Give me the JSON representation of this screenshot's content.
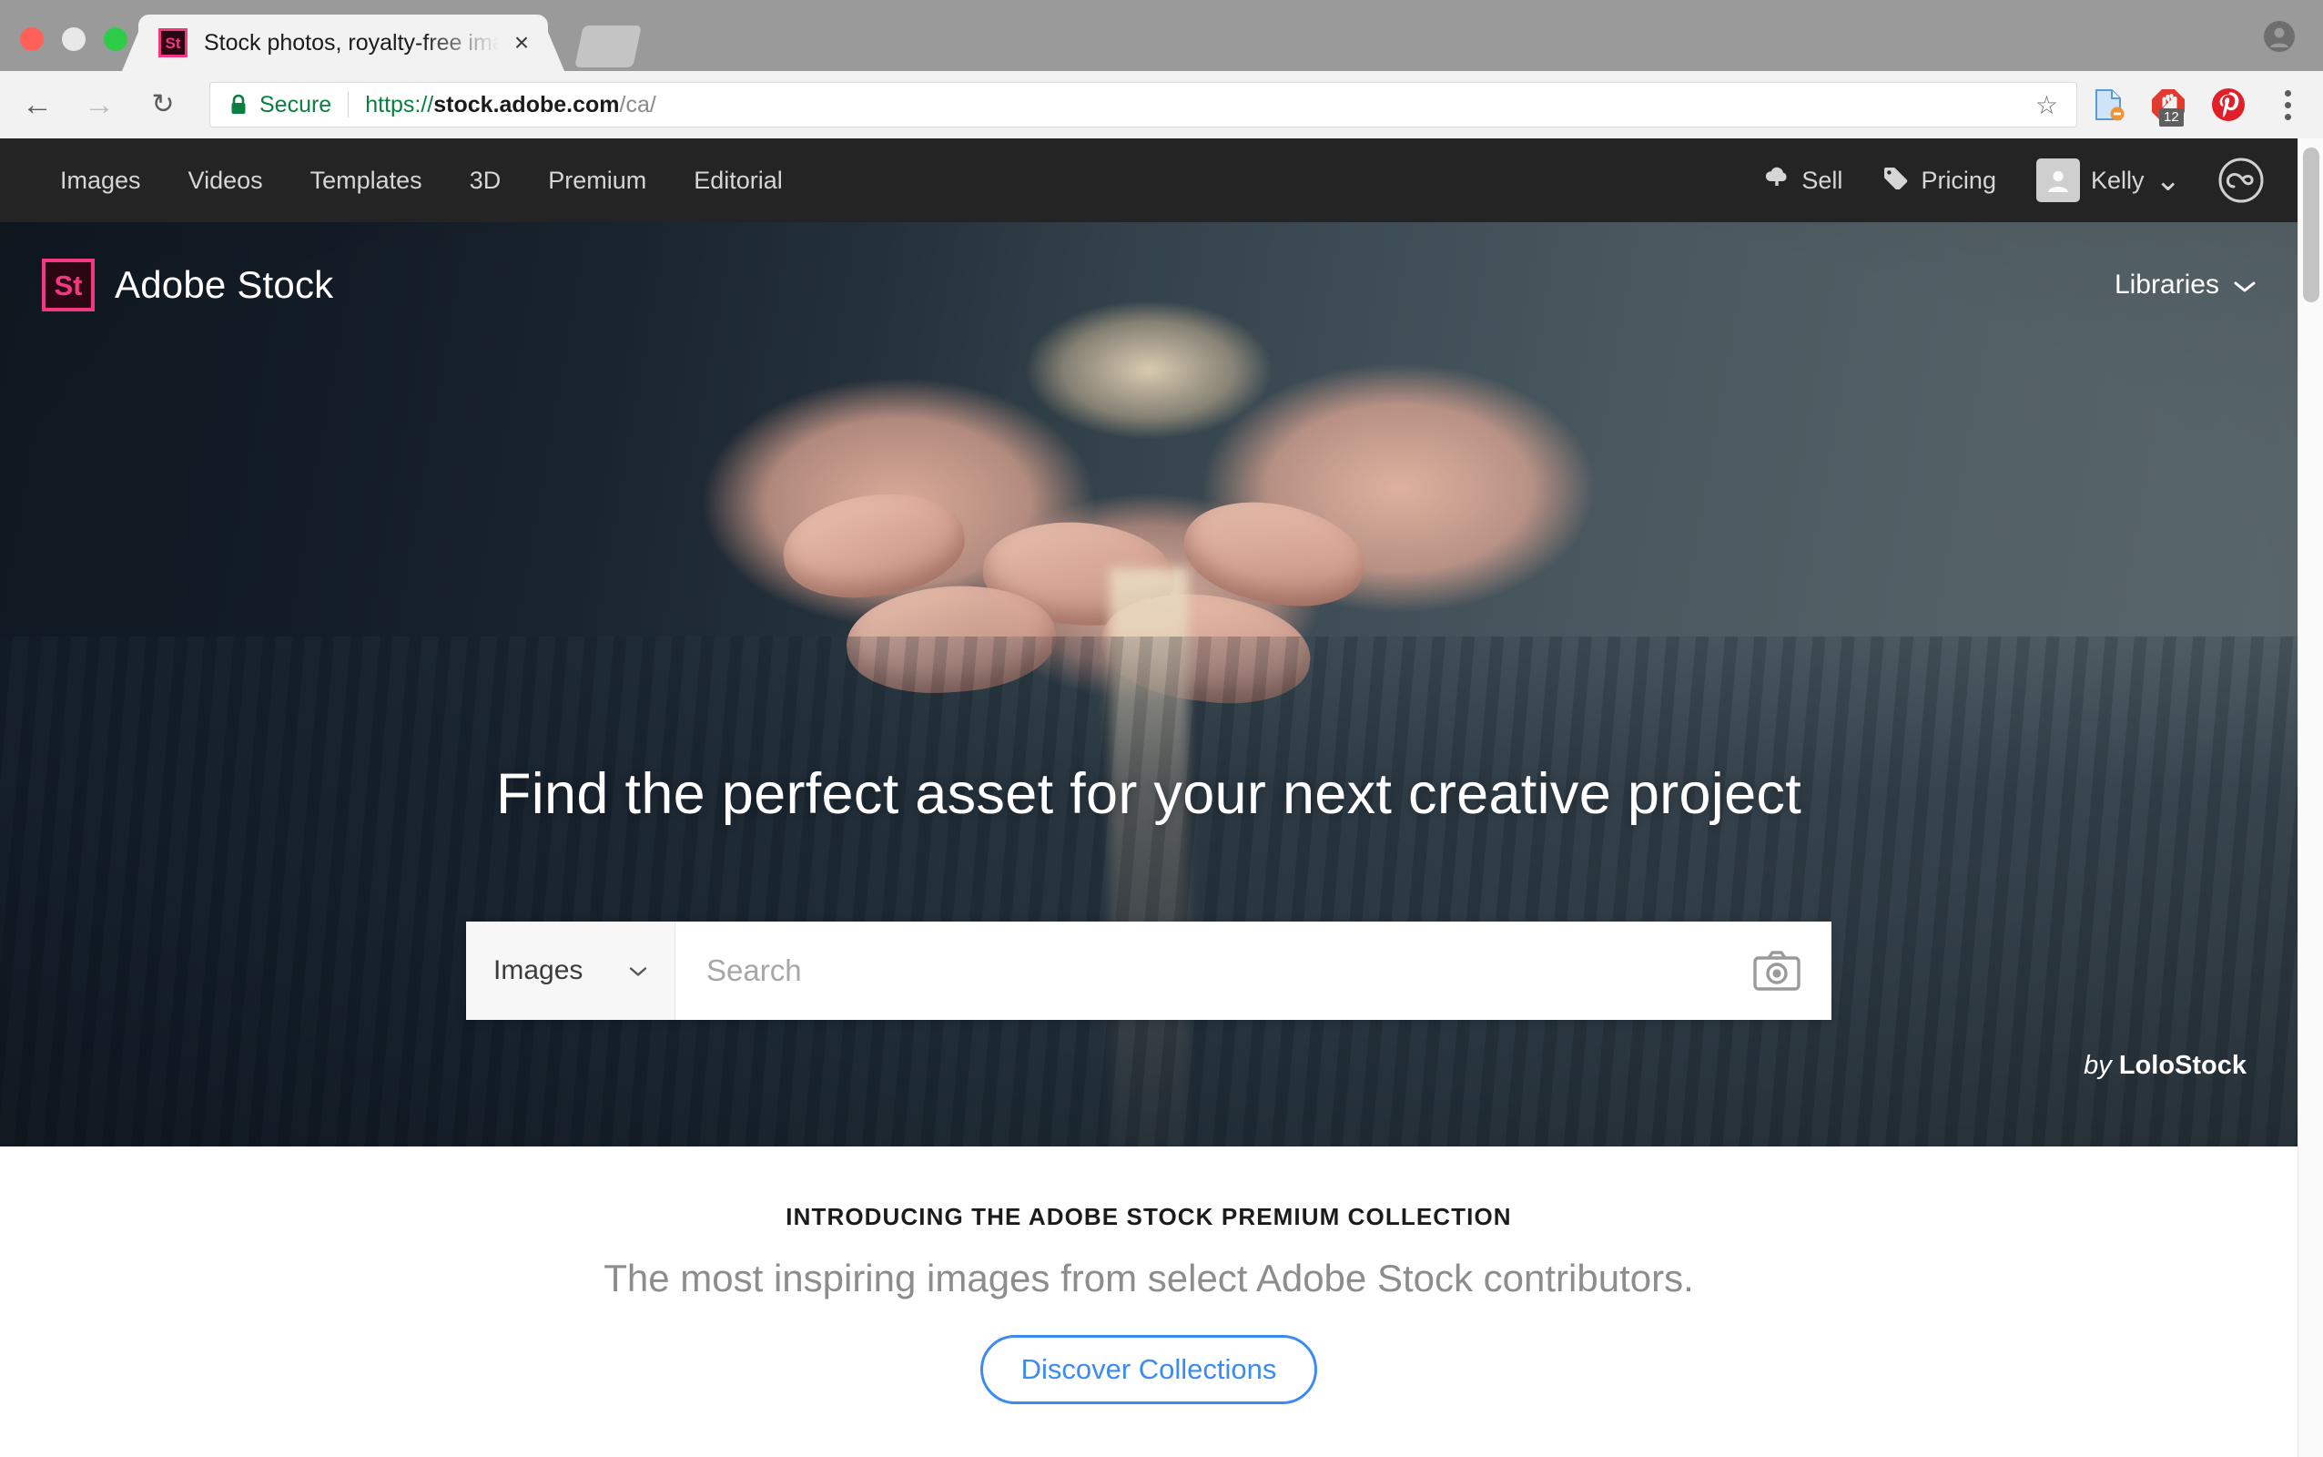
{
  "browser": {
    "tab": {
      "title": "Stock photos, royalty-free images, graphics, vectors & videos | Adobe Stock",
      "favicon_label": "St",
      "close_label": "×"
    },
    "new_tab_name": "new-tab-button",
    "back_label": "←",
    "forward_label": "→",
    "reload_label": "↻",
    "security_label": "Secure",
    "url": {
      "scheme": "https://",
      "host": "stock.adobe.com",
      "path": "/ca/"
    },
    "star_label": "☆",
    "extensions": [
      {
        "name": "document-extension-icon",
        "badge": ""
      },
      {
        "name": "adblock-extension-icon",
        "badge": "12"
      },
      {
        "name": "pinterest-extension-icon",
        "badge": ""
      }
    ],
    "menu_label": "chrome-menu"
  },
  "topnav": {
    "left_items": [
      {
        "label": "Images"
      },
      {
        "label": "Videos"
      },
      {
        "label": "Templates"
      },
      {
        "label": "3D"
      },
      {
        "label": "Premium"
      },
      {
        "label": "Editorial"
      }
    ],
    "sell_label": "Sell",
    "pricing_label": "Pricing",
    "user_name": "Kelly",
    "user_chevron": "⌄",
    "creative_cloud_label": "Creative Cloud"
  },
  "hero": {
    "brand_mark": "St",
    "brand_name": "Adobe Stock",
    "libraries_label": "Libraries",
    "libraries_chevron": "⌄",
    "title": "Find the perfect asset for your next creative project",
    "search": {
      "type_label": "Images",
      "type_chevron": "⌄",
      "placeholder": "Search",
      "value": "",
      "camera_label": "visual-search"
    },
    "credit_by": "by",
    "credit_author": "LoloStock"
  },
  "promo": {
    "eyebrow": "INTRODUCING THE ADOBE STOCK PREMIUM COLLECTION",
    "subtitle": "The most inspiring images from select Adobe Stock contributors.",
    "button_label": "Discover Collections"
  },
  "colors": {
    "accent_pink": "#f4377f",
    "nav_dark": "#242424",
    "link_blue": "#3b8bf0",
    "secure_green": "#0b7f3f",
    "hero_dark": "#131c26",
    "hero_light": "#5a676c"
  }
}
